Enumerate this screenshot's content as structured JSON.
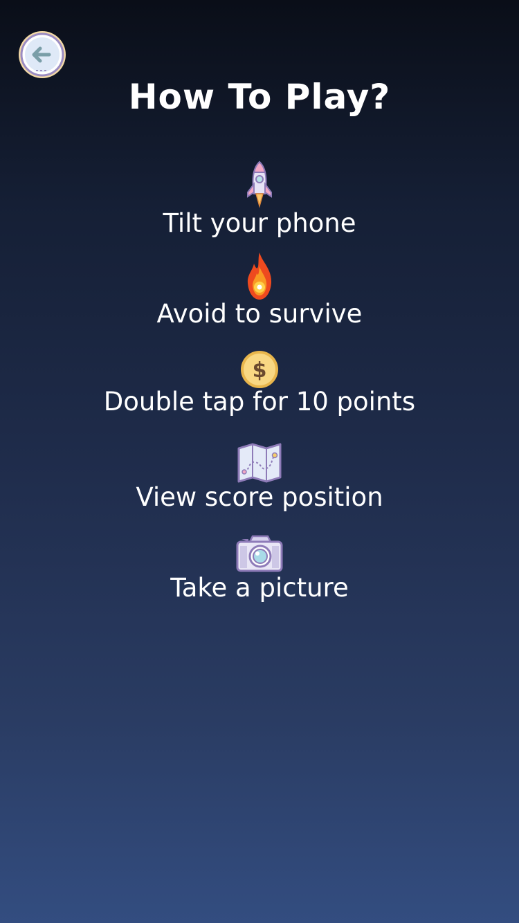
{
  "header": {
    "title": "How To Play?",
    "back_icon": "back-arrow-icon"
  },
  "instructions": [
    {
      "icon": "rocket-icon",
      "label": "Tilt your phone"
    },
    {
      "icon": "fireball-icon",
      "label": "Avoid to survive"
    },
    {
      "icon": "coin-icon",
      "label": "Double tap for 10 points"
    },
    {
      "icon": "map-icon",
      "label": "View score position"
    },
    {
      "icon": "camera-icon",
      "label": "Take a picture"
    }
  ],
  "colors": {
    "background_top": "#0a0e18",
    "background_bottom": "#334d80",
    "text": "#ffffff",
    "icon_outline": "#8e7bb8",
    "coin": "#f5cf6a"
  }
}
